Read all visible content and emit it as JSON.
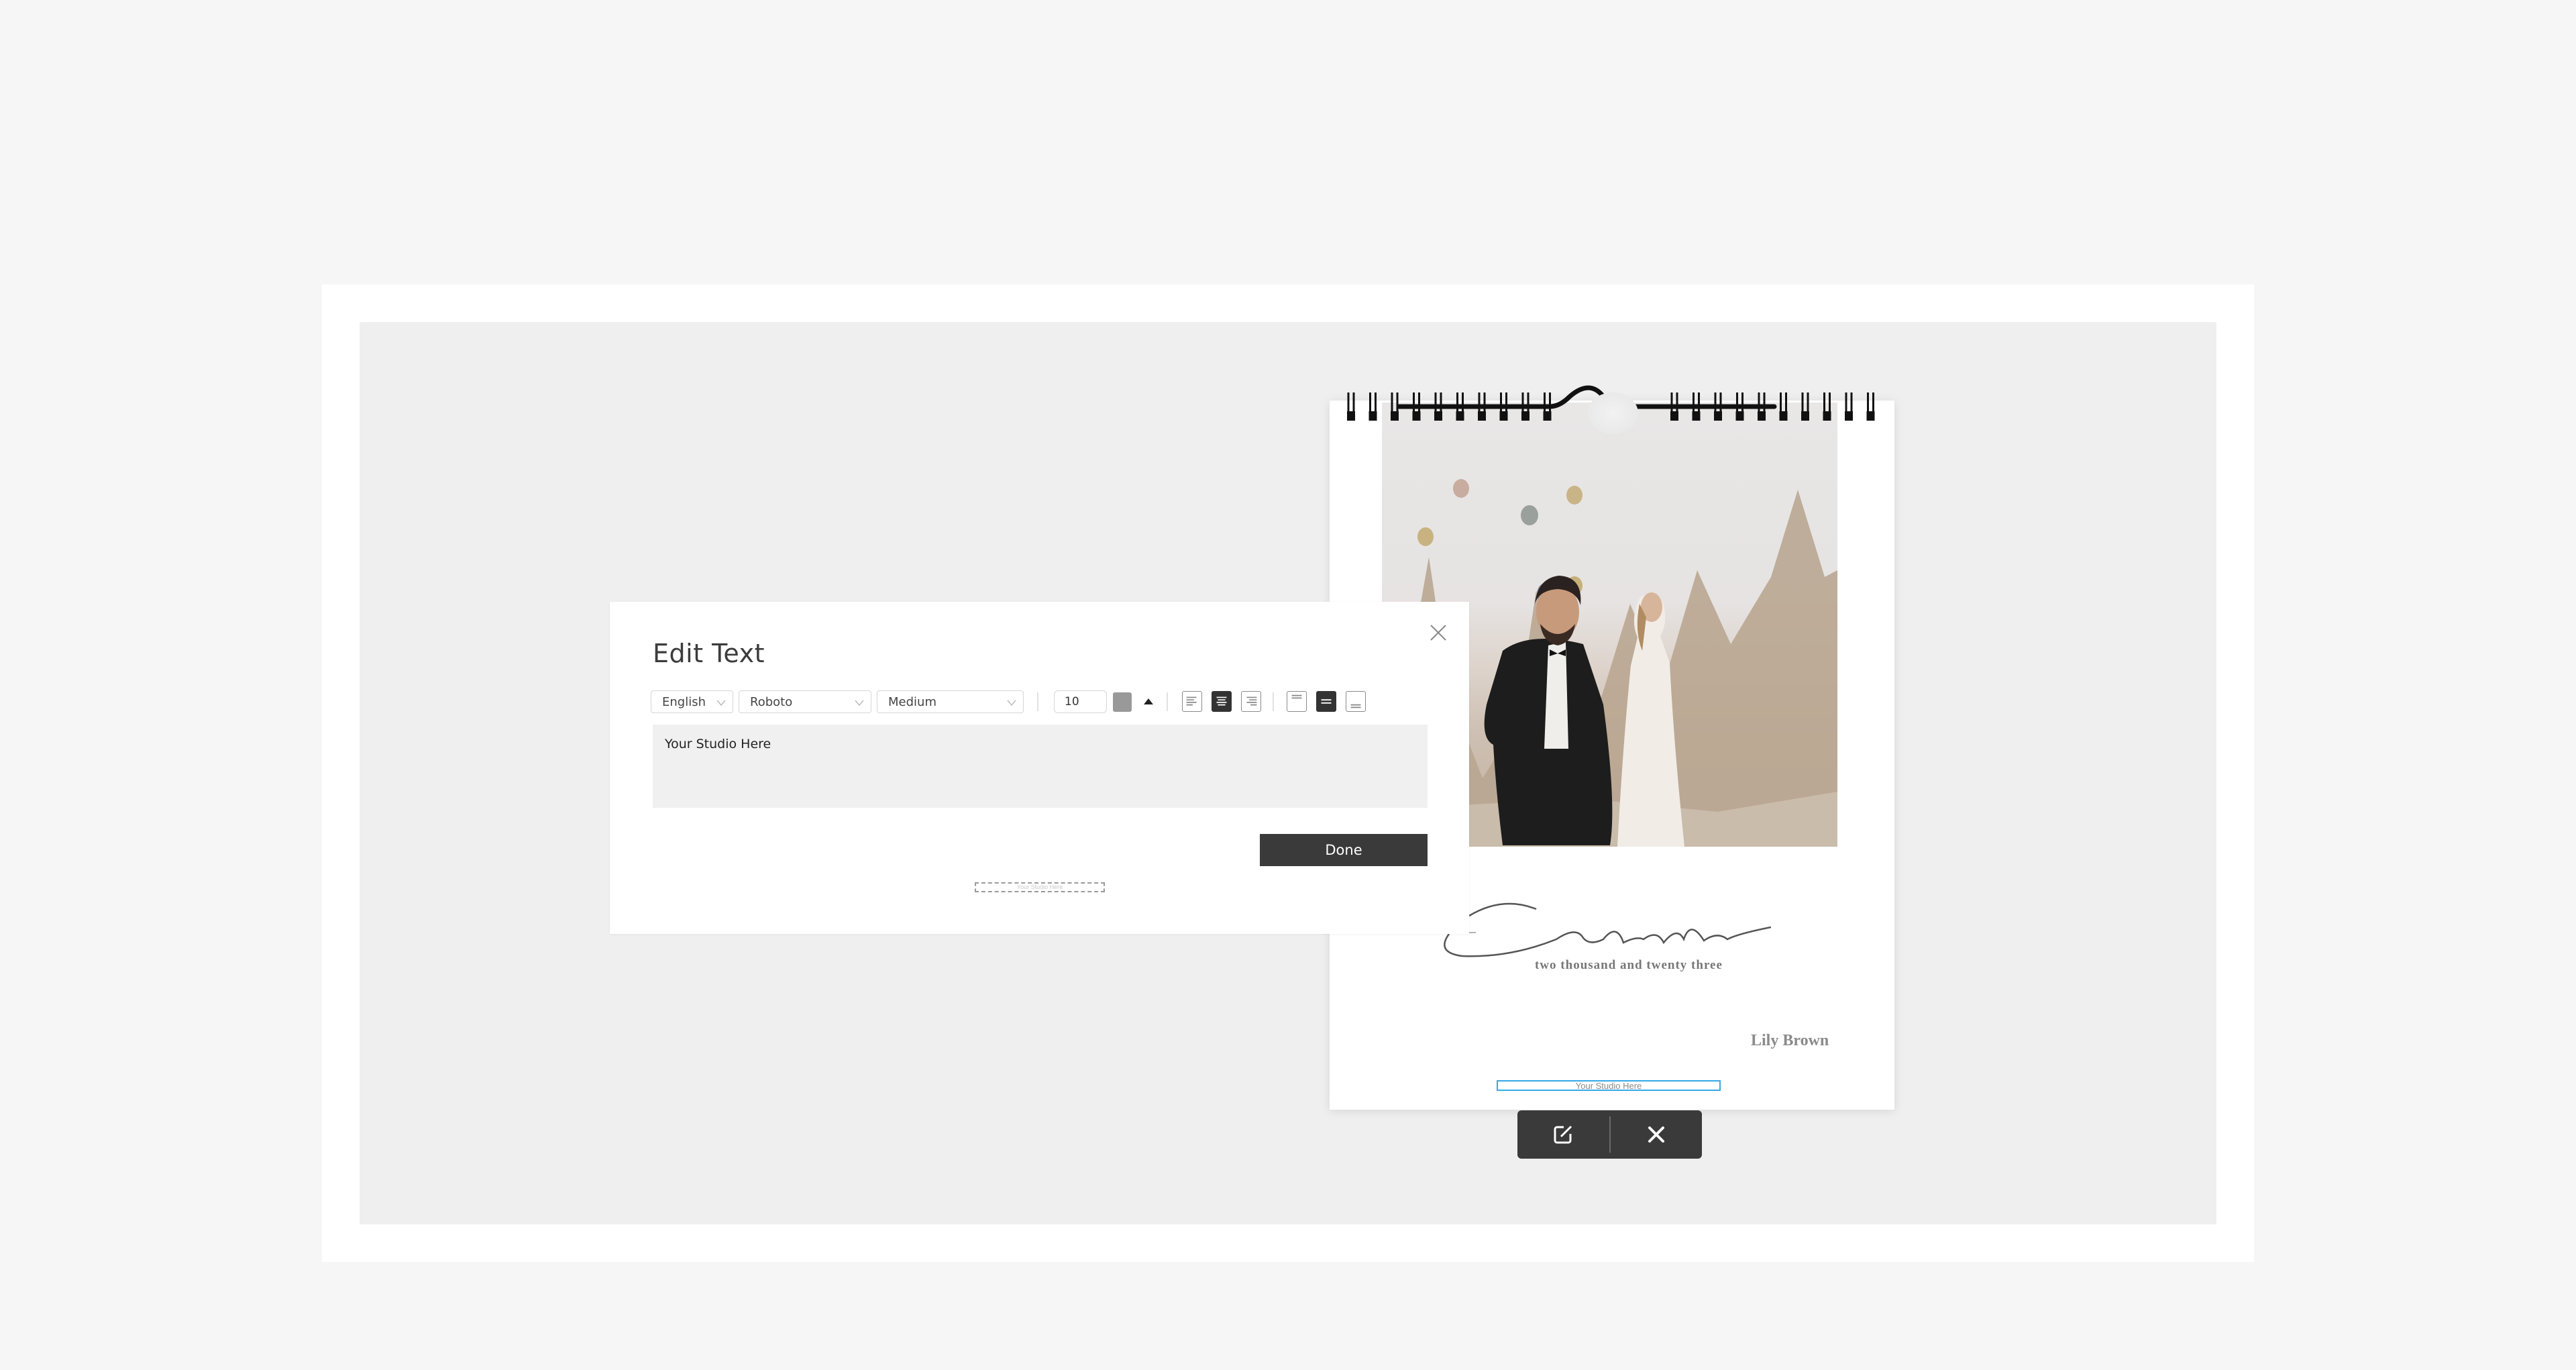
{
  "colors": {
    "page_background": "#f6f6f6",
    "frame": "#ffffff",
    "stage": "#efefef",
    "dark_ui": "#3a3a3a",
    "selection_outline": "#35a9e8",
    "text_color_swatch": "#999999"
  },
  "calendar": {
    "title_script": "Calendar",
    "subtitle": "two thousand and twenty three",
    "name": "Lily Brown",
    "studio_text": "Your Studio Here",
    "photo_alt": "Couple in wedding attire with hot air balloons over rock formations"
  },
  "element_toolbar": {
    "edit_icon": "edit-icon",
    "remove_icon": "close-icon"
  },
  "dialog": {
    "title": "Edit Text",
    "close_icon": "close-icon",
    "language_select": {
      "value": "English"
    },
    "font_select": {
      "value": "Roboto"
    },
    "weight_select": {
      "value": "Medium"
    },
    "font_size": "10",
    "text_color": "#999999",
    "align_options": [
      {
        "name": "align-left",
        "active": false
      },
      {
        "name": "align-center",
        "active": true
      },
      {
        "name": "align-right",
        "active": false
      }
    ],
    "valign_options": [
      {
        "name": "valign-top",
        "active": false
      },
      {
        "name": "valign-middle",
        "active": true
      },
      {
        "name": "valign-bottom",
        "active": false
      }
    ],
    "text_value": "Your Studio Here",
    "done_label": "Done",
    "preview_text": "Your Studio Here"
  }
}
